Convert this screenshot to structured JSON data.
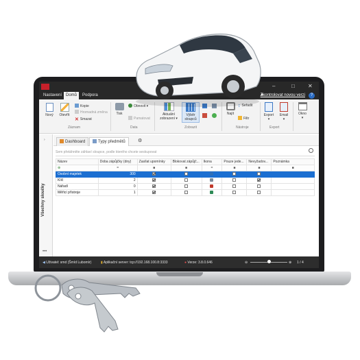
{
  "menu": {
    "tabs": [
      "Nastavení",
      "Domů",
      "Podpora"
    ],
    "active_tab": "Domů",
    "link": "Zkontrolovat novou verzi",
    "help": "?",
    "minimize": "–",
    "maximize": "□",
    "close": "✕"
  },
  "ribbon": {
    "new": "Nový",
    "open": "Otevřít",
    "copy": "Kopie",
    "bulk_edit": "Hromadná změna",
    "delete": "Smazat",
    "group_records": "Záznam",
    "print": "Tisk",
    "refresh": "Obnovit",
    "remember": "Pamatovat",
    "group_data": "Data",
    "current_view": "Aktuální zobrazení",
    "columns": "Výběr sloupců",
    "group_view": "Zobrazit",
    "find": "Najít",
    "sort": "Seřadit",
    "filter": "Filtr",
    "group_tools": "Nástroje",
    "export": "Export",
    "email": "Email",
    "group_export": "Export",
    "window": "Okno"
  },
  "sidebar": {
    "label": "Všechny sloučky",
    "more": "•••"
  },
  "tabs": [
    {
      "label": "Dashboard",
      "active": false
    },
    {
      "label": "Typy předmětů",
      "active": true
    }
  ],
  "search": {
    "placeholder": "Sem přetáhněte záhlaví sloupce, podle kterého chcete seskupovat"
  },
  "table": {
    "columns": [
      "Název",
      "Doba zápůjčky (dny)",
      "Zasílat upomínky",
      "Blokovat zápůjč...",
      "Ikona",
      "Pouze jede...",
      "Nevyžadov...",
      "Poznámka"
    ],
    "filter_row": [
      "⊕",
      "=",
      "■",
      "■",
      "=",
      "■",
      "■",
      "■"
    ],
    "rows": [
      {
        "name": "Osobní majetek",
        "days": "300",
        "remind": true,
        "block": false,
        "icon": "person-icon",
        "icon_color": "#2f6fb8",
        "only_one": false,
        "not_required": false,
        "note": "",
        "selected": true
      },
      {
        "name": "Klíč",
        "days": "2",
        "remind": true,
        "block": false,
        "icon": "key-icon",
        "icon_color": "#7b8a99",
        "only_one": false,
        "not_required": true,
        "note": "",
        "selected": false
      },
      {
        "name": "Nářadí",
        "days": "0",
        "remind": true,
        "block": false,
        "icon": "tools-icon",
        "icon_color": "#c0392b",
        "only_one": false,
        "not_required": false,
        "note": "",
        "selected": false
      },
      {
        "name": "Měřicí přístroje",
        "days": "1",
        "remind": true,
        "block": false,
        "icon": "meter-icon",
        "icon_color": "#2e8b57",
        "only_one": false,
        "not_required": false,
        "note": "",
        "selected": false
      }
    ]
  },
  "status": {
    "user": "Uživatel: smd (Šmíd Lubomír)",
    "server": "Aplikační server: tcp://192.168.100.8:3333",
    "version": "Verze: 3.8.0.646",
    "page": "1 / 4"
  },
  "colors": {
    "selection": "#1c6fd1",
    "status_bar": "#2d2d2d",
    "menu_bar": "#282828",
    "car_body": "#f4f5f6"
  }
}
